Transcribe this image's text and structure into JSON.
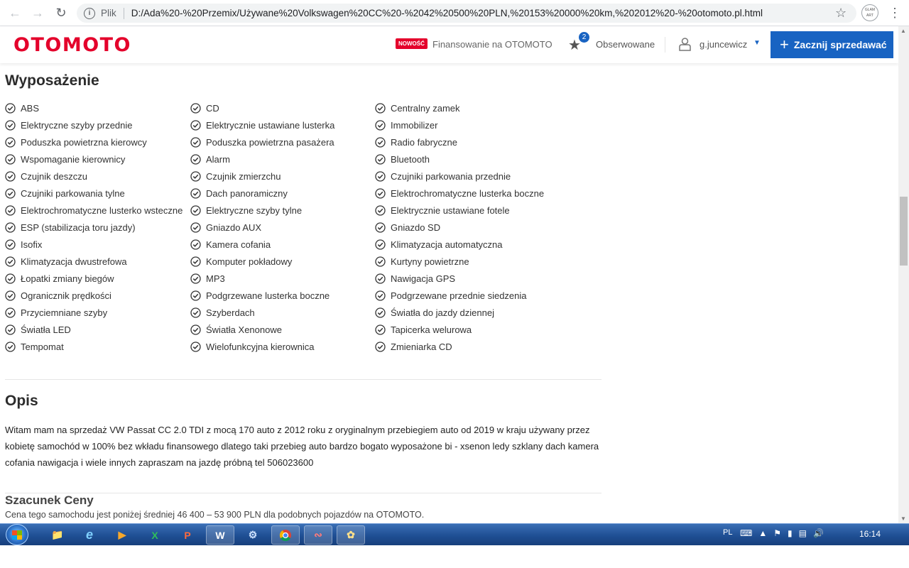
{
  "browser": {
    "back_icon": "arrow-left-icon",
    "forward_icon": "arrow-right-icon",
    "reload_icon": "reload-icon",
    "scheme_label": "Plik",
    "url": "D:/Ada%20-%20Przemix/Używane%20Volkswagen%20CC%20-%2042%20500%20PLN,%20153%20000%20km,%202012%20-%20otomoto.pl.html",
    "profile_label": "GLAM ART"
  },
  "header": {
    "logo": "OTOMOTO",
    "new_badge": "NOWOŚĆ",
    "financing_link": "Finansowanie na OTOMOTO",
    "favorites_count": "2",
    "favorites_label": "Obserwowane",
    "username": "g.juncewicz",
    "sell_button": "Zacznij sprzedawać",
    "brand_color": "#e4002b",
    "accent_color": "#1863c2"
  },
  "equipment": {
    "title": "Wyposażenie",
    "items": [
      "ABS",
      "CD",
      "Centralny zamek",
      "Elektryczne szyby przednie",
      "Elektrycznie ustawiane lusterka",
      "Immobilizer",
      "Poduszka powietrzna kierowcy",
      "Poduszka powietrzna pasażera",
      "Radio fabryczne",
      "Wspomaganie kierownicy",
      "Alarm",
      "Bluetooth",
      "Czujnik deszczu",
      "Czujnik zmierzchu",
      "Czujniki parkowania przednie",
      "Czujniki parkowania tylne",
      "Dach panoramiczny",
      "Elektrochromatyczne lusterka boczne",
      "Elektrochromatyczne lusterko wsteczne",
      "Elektryczne szyby tylne",
      "Elektrycznie ustawiane fotele",
      "ESP (stabilizacja toru jazdy)",
      "Gniazdo AUX",
      "Gniazdo SD",
      "Isofix",
      "Kamera cofania",
      "Klimatyzacja automatyczna",
      "Klimatyzacja dwustrefowa",
      "Komputer pokładowy",
      "Kurtyny powietrzne",
      "Łopatki zmiany biegów",
      "MP3",
      "Nawigacja GPS",
      "Ogranicznik prędkości",
      "Podgrzewane lusterka boczne",
      "Podgrzewane przednie siedzenia",
      "Przyciemniane szyby",
      "Szyberdach",
      "Światła do jazdy dziennej",
      "Światła LED",
      "Światła Xenonowe",
      "Tapicerka welurowa",
      "Tempomat",
      "Wielofunkcyjna kierownica",
      "Zmieniarka CD"
    ]
  },
  "description": {
    "title": "Opis",
    "text": "Witam mam na sprzedaż VW Passat CC 2.0 TDI z mocą 170 auto z 2012 roku z oryginalnym przebiegiem auto od 2019 w kraju używany przez kobietę samochód w 100% bez wkładu finansowego dlatego taki przebieg auto bardzo bogato wyposażone bi - xsenon ledy szklany dach kamera cofania nawigacja i wiele innych zapraszam na jazdę próbną tel 506023600"
  },
  "estimate": {
    "title": "Szacunek Ceny",
    "text": "Cena tego samochodu jest poniżej średniej 46 400 – 53 900 PLN dla podobnych pojazdów na OTOMOTO."
  },
  "taskbar": {
    "language": "PL",
    "time": "16:14",
    "apps": [
      "explorer",
      "internet-explorer",
      "media-player",
      "excel",
      "powerpoint",
      "word",
      "app-7",
      "chrome",
      "app-9",
      "app-10"
    ]
  }
}
